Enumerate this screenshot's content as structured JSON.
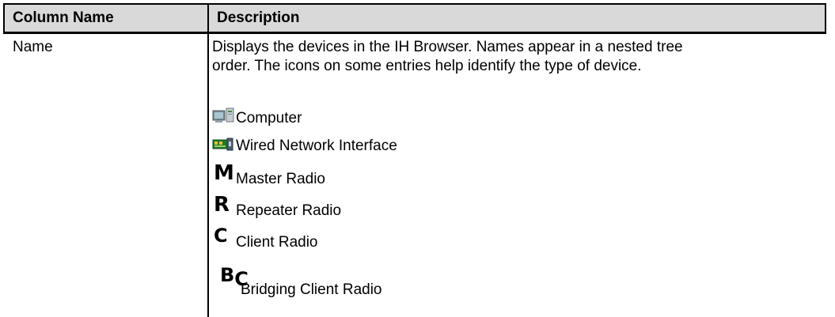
{
  "table": {
    "headers": [
      "Column Name",
      "Description"
    ],
    "row": {
      "name": "Name",
      "description_lines": [
        "Displays the devices in the IH Browser. Names appear in a nested tree",
        "order. The icons on some entries help identify the type of device."
      ],
      "legend": [
        {
          "icon": "computer-icon",
          "label": "Computer"
        },
        {
          "icon": "network-card-icon",
          "label": "Wired Network Interface"
        },
        {
          "icon": "master-radio-icon",
          "glyph": "M",
          "label": "Master Radio"
        },
        {
          "icon": "repeater-radio-icon",
          "glyph": "R",
          "label": "Repeater Radio"
        },
        {
          "icon": "client-radio-icon",
          "glyph": "C",
          "label": "Client Radio"
        },
        {
          "icon": "bridging-client-radio-icon",
          "glyph": "BC",
          "label": "Bridging Client Radio"
        }
      ]
    }
  }
}
